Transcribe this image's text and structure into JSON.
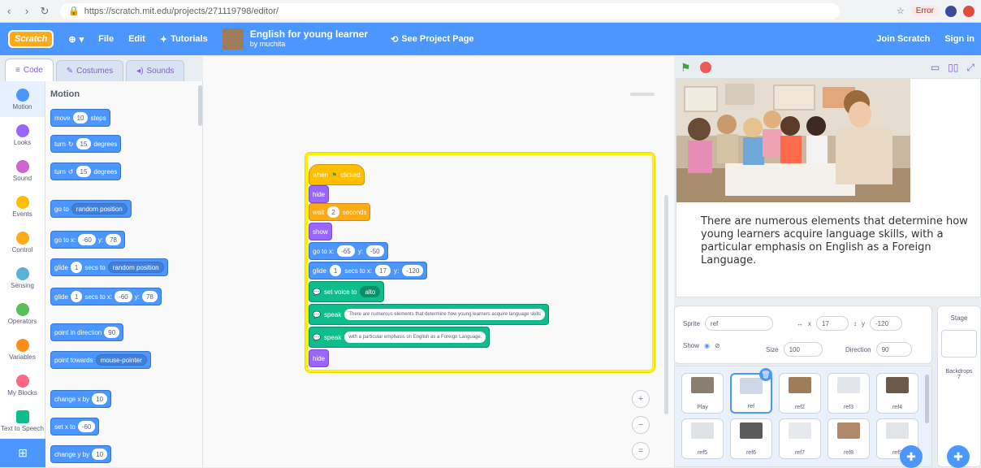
{
  "browser": {
    "url": "https://scratch.mit.edu/projects/271119798/editor/",
    "profile_label": "Error"
  },
  "menu": {
    "logo": "Scratch",
    "globe": "▾",
    "file": "File",
    "edit": "Edit",
    "tutorials": "Tutorials",
    "project_title": "English for young learner",
    "project_author": "by muchita",
    "see_project": "See Project Page",
    "join": "Join Scratch",
    "sign_in": "Sign in"
  },
  "tabs": {
    "code": "Code",
    "costumes": "Costumes",
    "sounds": "Sounds"
  },
  "categories": [
    {
      "label": "Motion",
      "color": "#4c97ff"
    },
    {
      "label": "Looks",
      "color": "#9966ff"
    },
    {
      "label": "Sound",
      "color": "#cf63cf"
    },
    {
      "label": "Events",
      "color": "#ffbf00"
    },
    {
      "label": "Control",
      "color": "#ffab19"
    },
    {
      "label": "Sensing",
      "color": "#5cb1d6"
    },
    {
      "label": "Operators",
      "color": "#59c059"
    },
    {
      "label": "Variables",
      "color": "#ff8c1a"
    },
    {
      "label": "My Blocks",
      "color": "#ff6680"
    },
    {
      "label": "Text to Speech",
      "color": "#0fbd8c"
    }
  ],
  "palette": {
    "title": "Motion",
    "move": "move",
    "move_steps": "10",
    "steps": "steps",
    "turn_right": "turn",
    "turn_right_val": "15",
    "degrees": "degrees",
    "turn_left": "turn",
    "turn_left_val": "15",
    "go_to": "go to",
    "go_to_target": "random position",
    "go_to_xy": "go to x:",
    "xy_x": "-60",
    "y_label": "y:",
    "xy_y": "78",
    "glide": "glide",
    "glide_secs": "1",
    "secs_to": "secs to",
    "glide_target": "random position",
    "glide_xy": "glide",
    "glide_xy_secs": "1",
    "glide_secs_x": "secs to x:",
    "glide_x": "-60",
    "glide_y": "78",
    "point_dir": "point in direction",
    "point_dir_val": "90",
    "point_towards": "point towards",
    "point_towards_target": "mouse-pointer",
    "change_x": "change x by",
    "change_x_val": "10",
    "set_x": "set x to",
    "set_x_val": "-60",
    "change_y": "change y by",
    "change_y_val": "10"
  },
  "script": {
    "when_flag": "when",
    "clicked": "clicked",
    "hide": "hide",
    "wait": "wait",
    "wait_val": "2",
    "seconds": "seconds",
    "show": "show",
    "goto": "go to x:",
    "goto_x": "-65",
    "goto_y_label": "y:",
    "goto_y": "-50",
    "glide": "glide",
    "glide_secs": "1",
    "secs_to_x": "secs to x:",
    "glide_x": "17",
    "glide_y_label": "y:",
    "glide_y": "-120",
    "set_voice": "set voice to",
    "voice": "alto",
    "speak": "speak",
    "speak1": "There are numerous elements that determine how young learners acquire language skills",
    "speak2": "with a particular emphasis on English as a Foreign Language.",
    "hide2": "hide"
  },
  "zoom": {
    "in": "+",
    "out": "−",
    "reset": "="
  },
  "stage": {
    "text": "There are numerous elements that determine how young learners acquire language skills, with a particular emphasis on English as a Foreign Language."
  },
  "sprite_info": {
    "sprite_label": "Sprite",
    "sprite_name": "ref",
    "x_label": "x",
    "x_val": "17",
    "y_label": "y",
    "y_val": "-120",
    "show_label": "Show",
    "size_label": "Size",
    "size_val": "100",
    "direction_label": "Direction",
    "direction_val": "90"
  },
  "sprites": [
    {
      "label": "Play",
      "color": "#8a7f6e"
    },
    {
      "label": "ref",
      "color": "#cfd8e6",
      "selected": true
    },
    {
      "label": "ref2",
      "color": "#a07d5a"
    },
    {
      "label": "ref3",
      "color": "#e2e5ea"
    },
    {
      "label": "ref4",
      "color": "#6b5a4a"
    },
    {
      "label": "ref5",
      "color": "#dfe3e8"
    },
    {
      "label": "ref6",
      "color": "#5b5b5b"
    },
    {
      "label": "ref7",
      "color": "#e6e9ed"
    },
    {
      "label": "ref8",
      "color": "#b08a6a"
    },
    {
      "label": "ref9",
      "color": "#e1e4e9"
    }
  ],
  "stage_pane": {
    "title": "Stage",
    "backdrops_label": "Backdrops",
    "backdrops_count": "7"
  }
}
